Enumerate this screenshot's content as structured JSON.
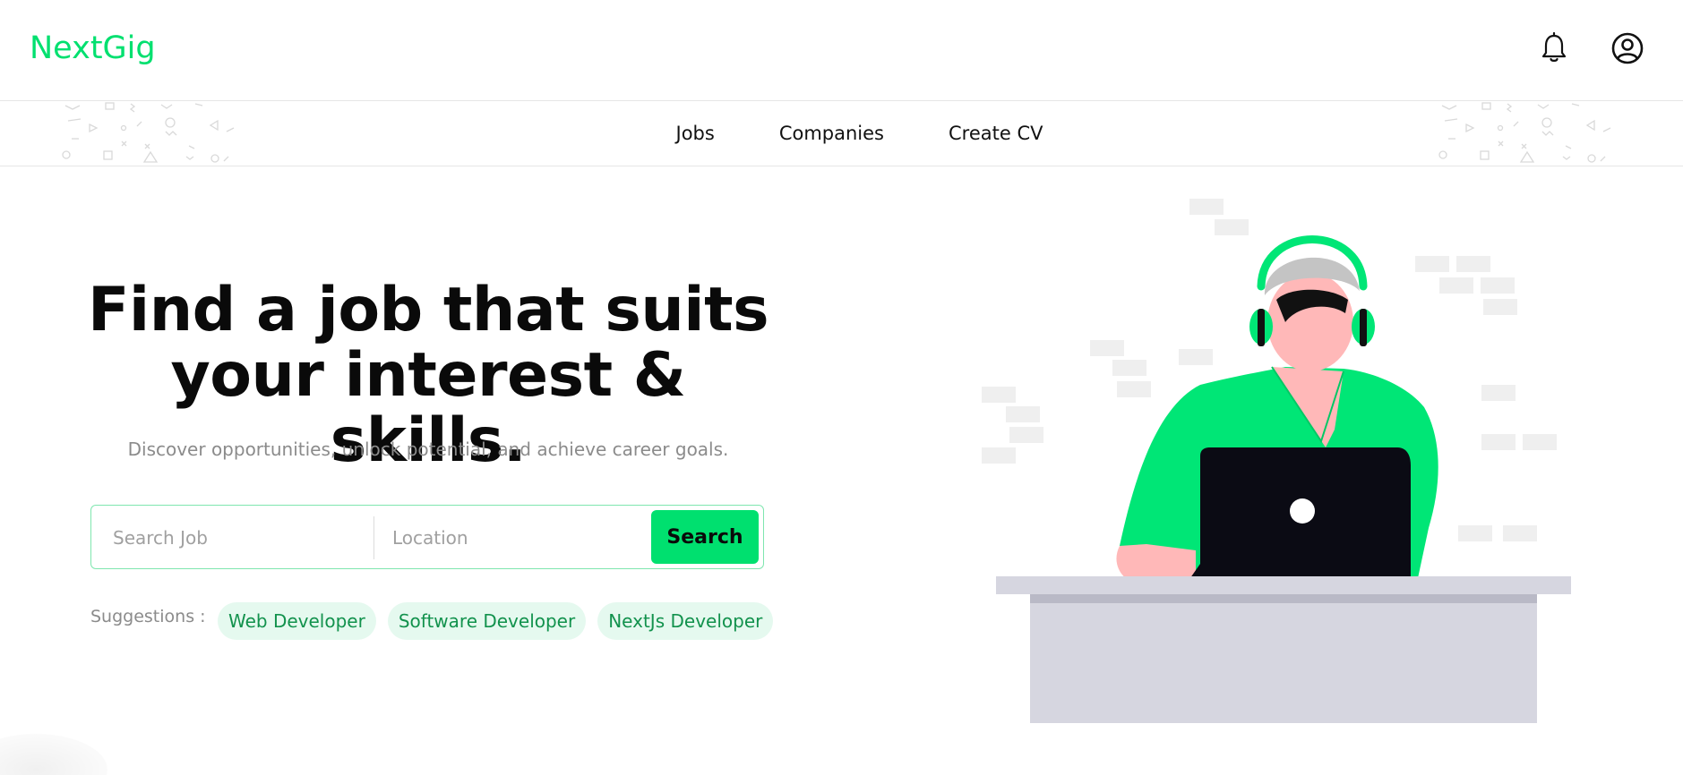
{
  "header": {
    "logo": "NextGig",
    "icons": [
      "bell-icon",
      "user-circle-icon"
    ]
  },
  "nav": {
    "items": [
      {
        "label": "Jobs"
      },
      {
        "label": "Companies"
      },
      {
        "label": "Create CV"
      }
    ]
  },
  "hero": {
    "title_line1": "Find a job that suits",
    "title_line2": "your interest & skills.",
    "subtitle": "Discover opportunities, unlock potential, and achieve career goals."
  },
  "search": {
    "job_placeholder": "Search Job",
    "job_value": "",
    "location_placeholder": "Location",
    "location_value": "",
    "button_label": "Search"
  },
  "suggestions": {
    "label": "Suggestions :",
    "items": [
      "Web Developer",
      "Software Developer",
      "NextJs Developer"
    ]
  },
  "colors": {
    "brand": "#00e06f",
    "chip_bg": "#e5f9ef",
    "chip_text": "#12924d",
    "laptop": "#0b0b14",
    "desk": "#d6d6e0"
  }
}
